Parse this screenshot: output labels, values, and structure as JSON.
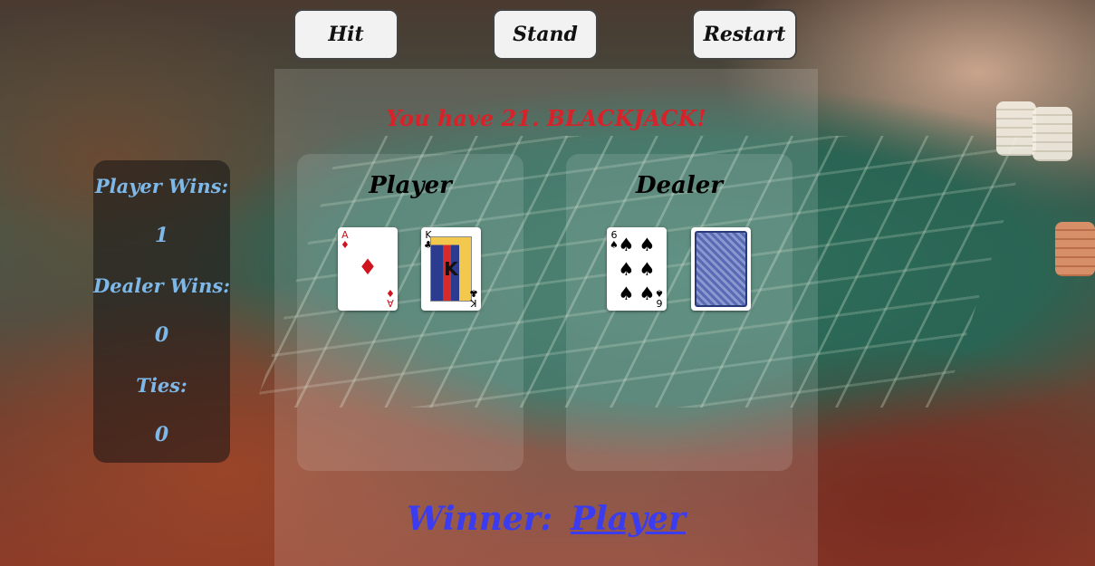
{
  "controls": {
    "hit_label": "Hit",
    "stand_label": "Stand",
    "restart_label": "Restart"
  },
  "scoreboard": {
    "player_wins_label": "Player Wins:",
    "player_wins": "1",
    "dealer_wins_label": "Dealer Wins:",
    "dealer_wins": "0",
    "ties_label": "Ties:",
    "ties": "0"
  },
  "message": "You have 21. BLACKJACK!",
  "player": {
    "title": "Player",
    "cards": [
      {
        "rank": "A",
        "suit": "diamonds",
        "suit_symbol": "♦"
      },
      {
        "rank": "K",
        "suit": "clubs",
        "suit_symbol": "♣"
      }
    ]
  },
  "dealer": {
    "title": "Dealer",
    "cards": [
      {
        "rank": "6",
        "suit": "spades",
        "suit_symbol": "♠"
      },
      {
        "rank": "",
        "suit": "hidden",
        "suit_symbol": ""
      }
    ]
  },
  "result": {
    "label": "Winner:",
    "winner": "Player"
  },
  "colors": {
    "message": "#d8222a",
    "winner": "#3b3bf0",
    "score_text": "#7db8e8"
  }
}
